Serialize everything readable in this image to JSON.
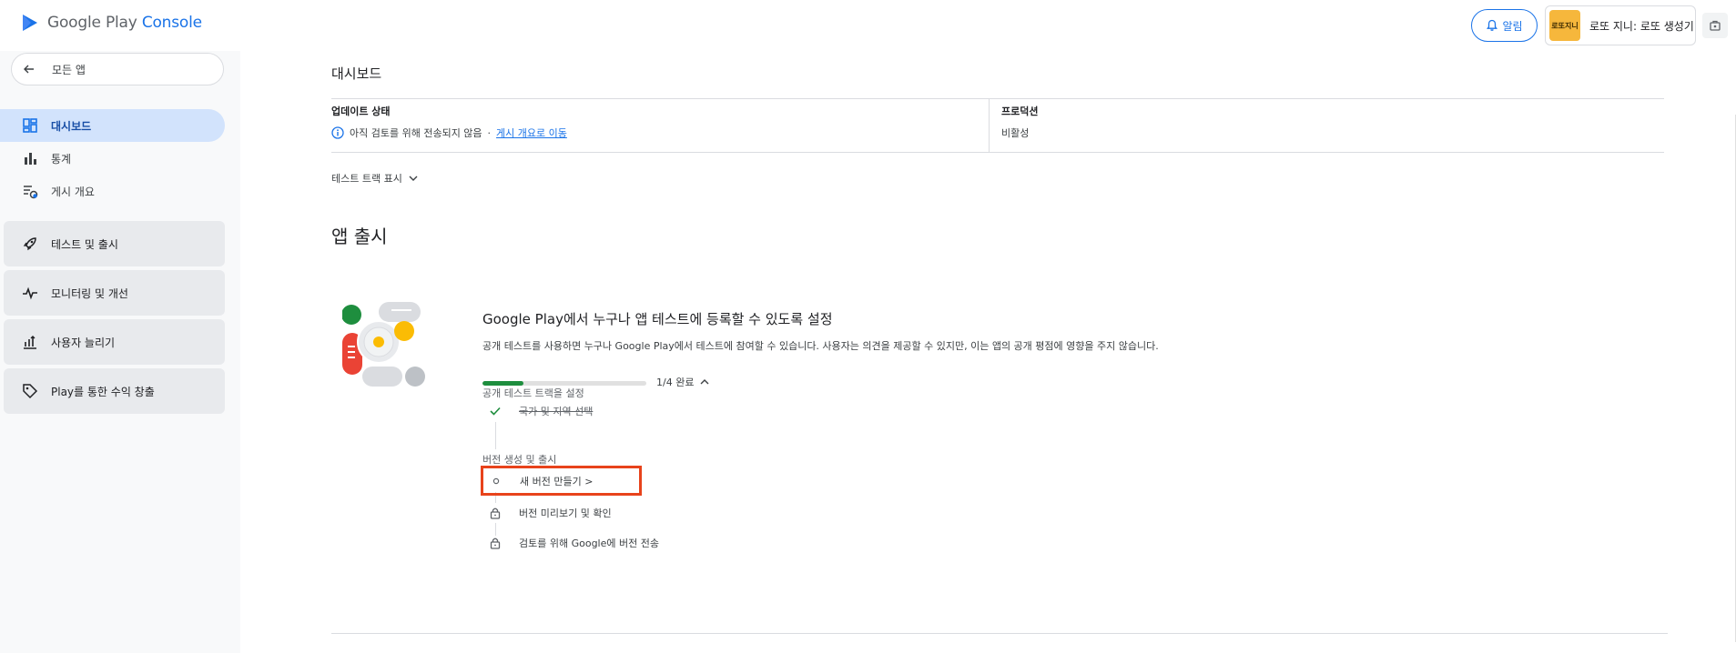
{
  "header": {
    "logo_google": "Google Play ",
    "logo_console": "Console",
    "alerts_label": "알림",
    "account_name": "로또 지니: 로또 생성기",
    "avatar_text": "로또지니"
  },
  "sidebar": {
    "back_label": "모든 앱",
    "items": [
      {
        "label": "대시보드",
        "icon": "dashboard-icon",
        "active": true
      },
      {
        "label": "통계",
        "icon": "bar-chart-icon"
      },
      {
        "label": "게시 개요",
        "icon": "publishing-overview-icon"
      }
    ],
    "groups": [
      {
        "label": "테스트 및 출시",
        "icon": "rocket-icon"
      },
      {
        "label": "모니터링 및 개선",
        "icon": "vitals-icon"
      },
      {
        "label": "사용자 늘리기",
        "icon": "grow-users-icon"
      },
      {
        "label": "Play를 통한 수익 창출",
        "icon": "tag-icon"
      }
    ]
  },
  "main": {
    "page_title": "대시보드",
    "update_status": {
      "label": "업데이트 상태",
      "value": "아직 검토를 위해 전송되지 않음",
      "separator": "·",
      "link": "게시 개요로 이동"
    },
    "production": {
      "label": "프로덕션",
      "value": "비활성"
    },
    "test_track_toggle": "테스트 트랙 표시",
    "section_title": "앱 출시",
    "card": {
      "title": "Google Play에서 누구나 앱 테스트에 등록할 수 있도록 설정",
      "description": "공개 테스트를 사용하면 누구나 Google Play에서 테스트에 참여할 수 있습니다. 사용자는 의견을 제공할 수 있지만, 이는 앱의 공개 평점에 영향을 주지 않습니다.",
      "progress_fraction": 0.25,
      "progress_text": "1/4 완료",
      "group1_label": "공개 테스트 트랙을 설정",
      "step1_label": "국가 및 지역 선택",
      "group2_label": "버전 생성 및 출시",
      "step2_label": "새 버전 만들기 >",
      "step3_label": "버전 미리보기 및 확인",
      "step4_label": "검토를 위해 Google에 버전 전송"
    }
  },
  "colors": {
    "accent": "#1a73e8",
    "active_nav": "#d2e3fc",
    "progress": "#1e8e3e",
    "highlight": "#e8431b"
  }
}
